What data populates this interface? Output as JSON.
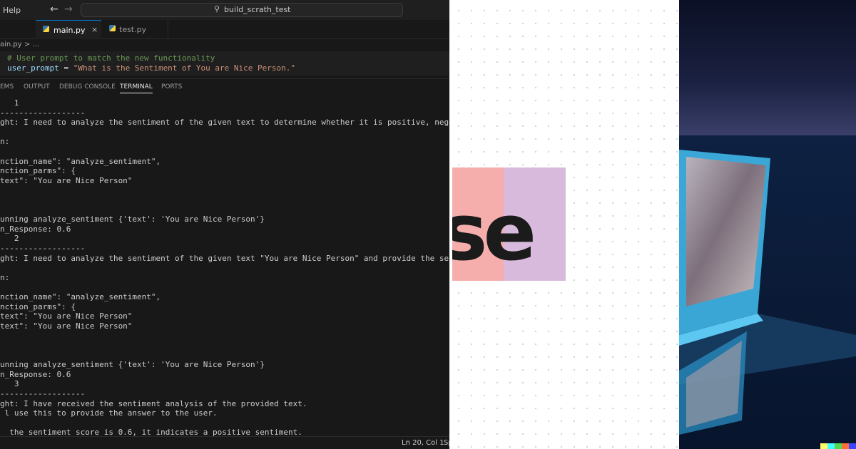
{
  "window": {
    "menu_help": "Help",
    "back_icon": "arrow-left-icon",
    "forward_icon": "arrow-right-icon",
    "search_icon": "search-icon",
    "command_center": "build_scrath_test"
  },
  "tabs": [
    {
      "label": "main.py",
      "active": true,
      "icon": "python-file-icon"
    },
    {
      "label": "test.py",
      "active": false,
      "icon": "python-file-icon"
    }
  ],
  "breadcrumb": "ain.py > ...",
  "editor": {
    "comment": "# User prompt to match the new functionality",
    "var": "user_prompt",
    "op": " = ",
    "value": "\"What is the Sentiment of You are Nice Person.\""
  },
  "panel_tabs": [
    "EMS",
    "OUTPUT",
    "DEBUG CONSOLE",
    "TERMINAL",
    "PORTS"
  ],
  "terminal": [
    "   1",
    "------------------",
    "ght: I need to analyze the sentiment of the given text to determine whether it is positive, negative, or neutral.",
    "",
    "n:",
    "",
    "nction_name\": \"analyze_sentiment\",",
    "nction_parms\": {",
    "text\": \"You are Nice Person\"",
    "",
    "",
    "",
    "unning analyze_sentiment {'text': 'You are Nice Person'}",
    "n_Response: 0.6",
    "   2",
    "------------------",
    "ght: I need to analyze the sentiment of the given text \"You are Nice Person\" and provide the sentiment analysis.",
    "",
    "n:",
    "",
    "nction_name\": \"analyze_sentiment\",",
    "nction_parms\": {",
    "text\": \"You are Nice Person\"",
    "text\": \"You are Nice Person\"",
    "",
    "",
    "",
    "unning analyze_sentiment {'text': 'You are Nice Person'}",
    "n_Response: 0.6",
    "   3",
    "------------------",
    "ght: I have received the sentiment analysis of the provided text.",
    " l use this to provide the answer to the user.",
    "",
    "  the sentiment score is 0.6, it indicates a positive sentiment."
  ],
  "statusbar": {
    "position": "Ln 20, Col 1",
    "spaces": "Sp"
  },
  "logo": {
    "text": "se",
    "colors": {
      "left": "#f6aeac",
      "right": "#d8bbdc",
      "text": "#1b1b1b"
    }
  },
  "accent_colors": {
    "vscode_active_tab": "#0078d4",
    "string": "#ce9178",
    "comment": "#6a9955",
    "variable": "#9cdcfe"
  },
  "image_strip_colors": [
    "#ffff66",
    "#42ffff",
    "#51da4c",
    "#ff6e3c",
    "#3c46ff"
  ]
}
